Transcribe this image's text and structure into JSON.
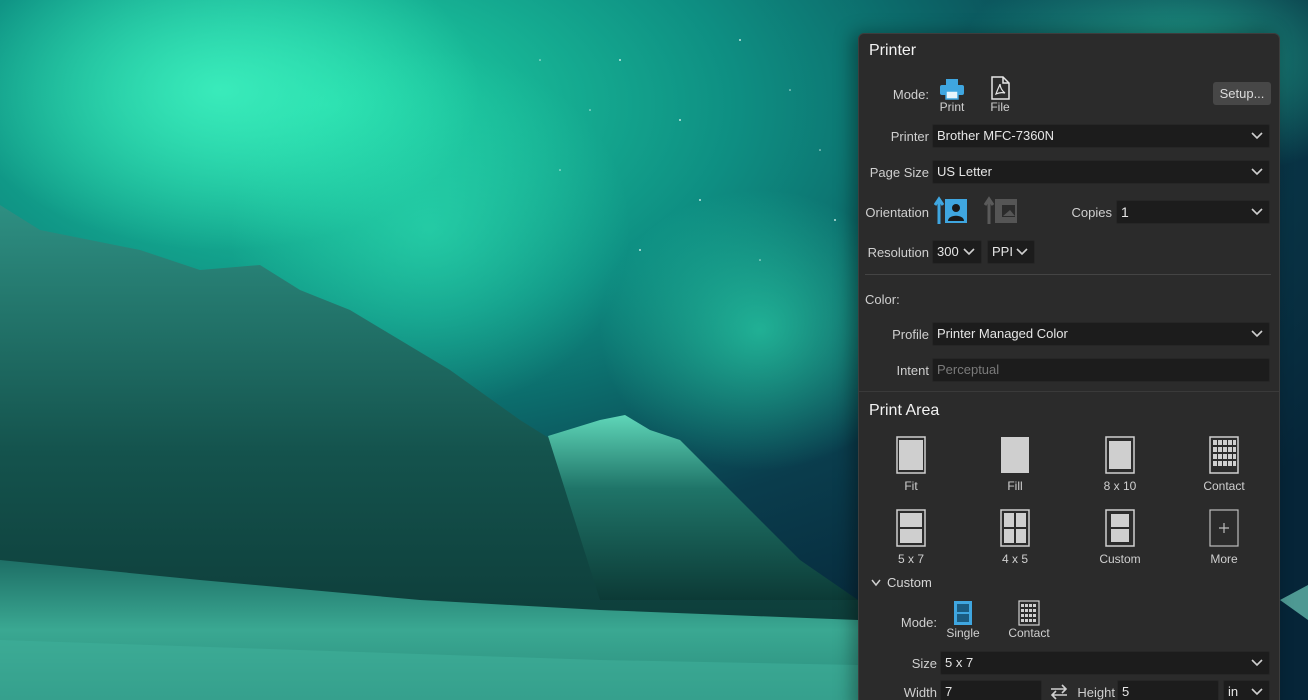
{
  "panel": {
    "title": "Printer",
    "mode": {
      "label": "Mode:",
      "options": [
        {
          "label": "Print",
          "icon": "printer-icon",
          "selected": true
        },
        {
          "label": "File",
          "icon": "pdf-file-icon",
          "selected": false
        }
      ],
      "setup_label": "Setup..."
    },
    "printer": {
      "label": "Printer",
      "value": "Brother MFC-7360N"
    },
    "page_size": {
      "label": "Page Size",
      "value": "US Letter"
    },
    "orientation": {
      "label": "Orientation",
      "selected": "portrait"
    },
    "copies": {
      "label": "Copies",
      "value": "1"
    },
    "resolution": {
      "label": "Resolution",
      "value": "300",
      "unit": "PPI"
    },
    "color": {
      "heading": "Color:",
      "profile": {
        "label": "Profile",
        "value": "Printer Managed Color"
      },
      "intent": {
        "label": "Intent",
        "value": "Perceptual"
      }
    }
  },
  "print_area": {
    "title": "Print Area",
    "options": [
      {
        "label": "Fit",
        "icon": "fit-layout-icon"
      },
      {
        "label": "Fill",
        "icon": "fill-layout-icon"
      },
      {
        "label": "8 x 10",
        "icon": "8x10-layout-icon"
      },
      {
        "label": "Contact",
        "icon": "contact-sheet-icon"
      },
      {
        "label": "5 x 7",
        "icon": "5x7-layout-icon"
      },
      {
        "label": "4 x 5",
        "icon": "4x5-layout-icon"
      },
      {
        "label": "Custom",
        "icon": "custom-layout-icon"
      },
      {
        "label": "More",
        "icon": "plus-icon"
      }
    ],
    "custom": {
      "heading": "Custom",
      "mode_label": "Mode:",
      "modes": [
        {
          "label": "Single",
          "icon": "single-layout-icon",
          "selected": true
        },
        {
          "label": "Contact",
          "icon": "contact-grid-icon",
          "selected": false
        }
      ],
      "size": {
        "label": "Size",
        "value": "5 x 7"
      },
      "width": {
        "label": "Width",
        "value": "7"
      },
      "height": {
        "label": "Height",
        "value": "5"
      },
      "unit": "in"
    }
  },
  "colors": {
    "accent": "#3fa6e0",
    "panel_bg": "#2b2b2b",
    "field_bg": "#1c1c1c"
  }
}
